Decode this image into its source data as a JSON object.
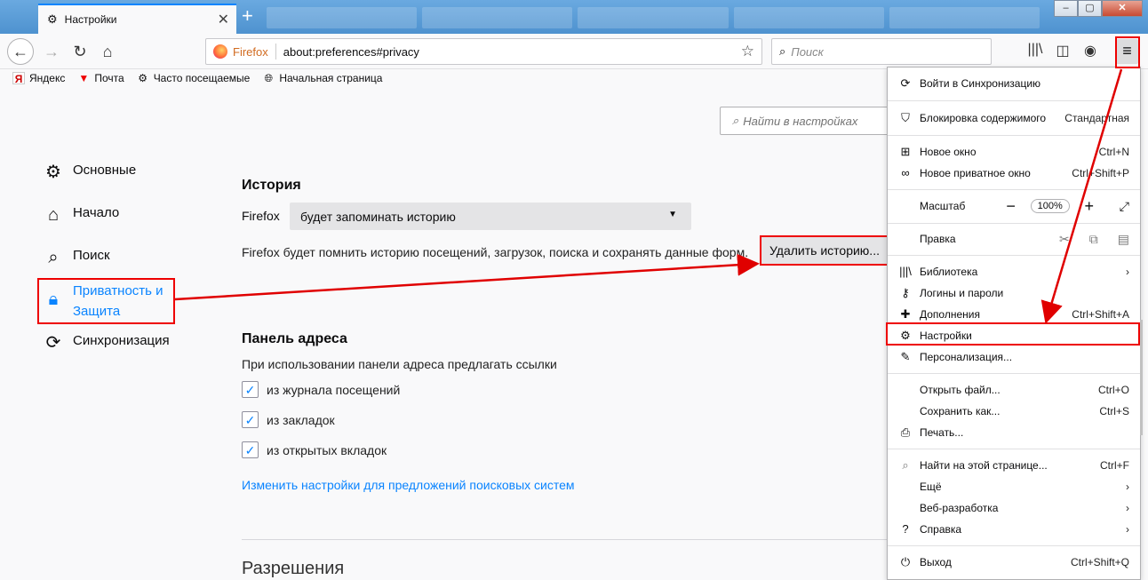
{
  "tab": {
    "title": "Настройки",
    "close": "✕",
    "new": "+"
  },
  "window": {
    "minimize": "–",
    "maximize": "▢",
    "close": "✕"
  },
  "nav": {
    "identity": "Firefox",
    "url": "about:preferences#privacy",
    "search_placeholder": "Поиск"
  },
  "bookmarks": [
    {
      "label": "Яндекс",
      "icon": "yandex-icon"
    },
    {
      "label": "Почта",
      "icon": "mail-icon"
    },
    {
      "label": "Часто посещаемые",
      "icon": "gear-icon"
    },
    {
      "label": "Начальная страница",
      "icon": "globe-icon"
    }
  ],
  "prefs_search_placeholder": "Найти в настройках",
  "categories": {
    "general": "Основные",
    "home": "Начало",
    "search": "Поиск",
    "privacy": "Приватность и Защита",
    "sync": "Синхронизация"
  },
  "history": {
    "heading": "История",
    "firefox_label": "Firefox",
    "mode": "будет запоминать историю",
    "description": "Firefox будет помнить историю посещений, загрузок, поиска и сохранять данные форм.",
    "clear_button": "Удалить историю..."
  },
  "address_bar": {
    "heading": "Панель адреса",
    "description": "При использовании панели адреса предлагать ссылки",
    "options": [
      "из журнала посещений",
      "из закладок",
      "из открытых вкладок"
    ],
    "link": "Изменить настройки для предложений поисковых систем"
  },
  "permissions_heading": "Разрешения",
  "menu": {
    "sync": "Войти в Синхронизацию",
    "content_blocking": "Блокировка содержимого",
    "content_blocking_value": "Стандартная",
    "new_window": "Новое окно",
    "new_window_key": "Ctrl+N",
    "new_private": "Новое приватное окно",
    "new_private_key": "Ctrl+Shift+P",
    "zoom": "Масштаб",
    "zoom_value": "100%",
    "edit": "Правка",
    "library": "Библиотека",
    "logins": "Логины и пароли",
    "addons": "Дополнения",
    "addons_key": "Ctrl+Shift+A",
    "settings": "Настройки",
    "customize": "Персонализация...",
    "open_file": "Открыть файл...",
    "open_file_key": "Ctrl+O",
    "save_as": "Сохранить как...",
    "save_as_key": "Ctrl+S",
    "print": "Печать...",
    "find": "Найти на этой странице...",
    "find_key": "Ctrl+F",
    "more": "Ещё",
    "webdev": "Веб-разработка",
    "help": "Справка",
    "quit": "Выход",
    "quit_key": "Ctrl+Shift+Q"
  },
  "colors": {
    "accent": "#0a84ff",
    "highlight": "#e00000"
  }
}
